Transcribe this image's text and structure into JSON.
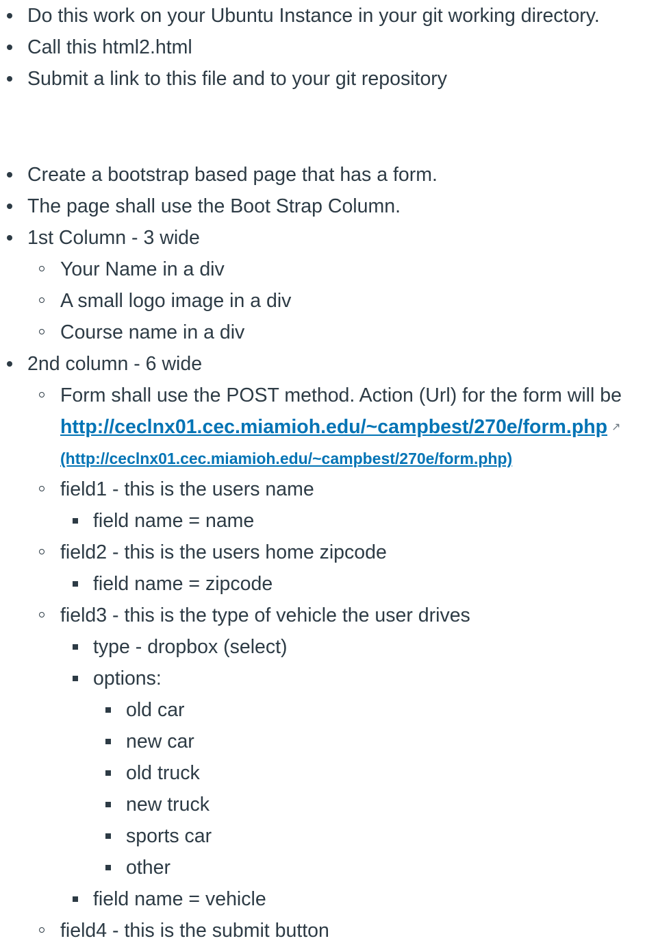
{
  "intro_items": [
    "Do this work on your Ubuntu Instance in your git working directory.",
    "Call this html2.html",
    "Submit a link to this file and to your git repository"
  ],
  "main_items": {
    "item1": "Create a bootstrap based page that has a form.",
    "item2": "The page shall use the Boot Strap Column.",
    "col1": {
      "label": "1st Column - 3 wide",
      "items": [
        "Your Name in a div",
        "A small logo image in a div",
        "Course name in a div"
      ]
    },
    "col2": {
      "label": "2nd column - 6 wide",
      "form_text": "Form shall use the POST method. Action (Url) for the form will be",
      "form_link": "http://ceclnx01.cec.miamioh.edu/~campbest/270e/form.php",
      "form_link_paren": "(http://ceclnx01.cec.miamioh.edu/~campbest/270e/form.php)",
      "field1": "field1 - this is the users name",
      "field1_name": "field name = name",
      "field2": "field2 - this is the users home zipcode",
      "field2_name": "field name = zipcode",
      "field3": "field3 - this is the type of vehicle the user drives",
      "field3_type": "type - dropbox (select)",
      "field3_options_label": "options:",
      "field3_options": [
        "old car",
        "new car",
        "old truck",
        "new truck",
        "sports car",
        "other"
      ],
      "field3_name": "field name = vehicle",
      "field4": "field4 - this is the submit button"
    }
  },
  "icons": {
    "external_link": "external-link-icon"
  }
}
